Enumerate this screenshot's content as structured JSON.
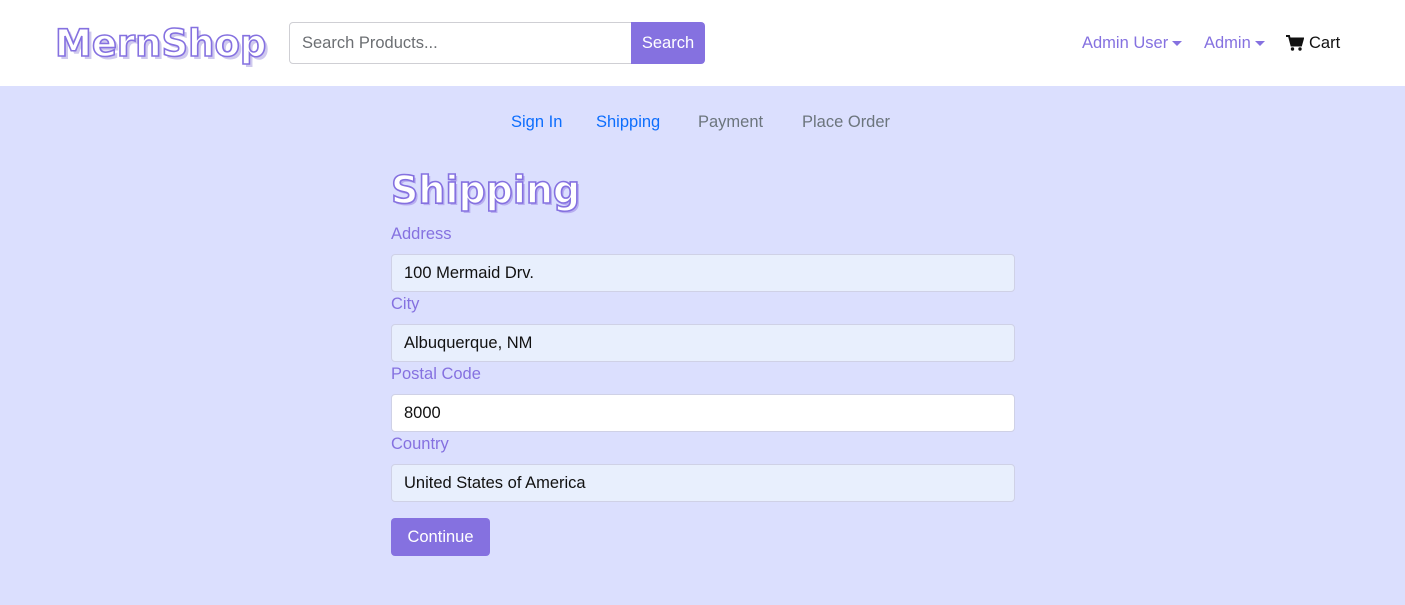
{
  "brand": {
    "name": "MernShop"
  },
  "search": {
    "placeholder": "Search Products...",
    "button_label": "Search"
  },
  "nav": {
    "user_menu_label": "Admin User",
    "admin_menu_label": "Admin",
    "cart_label": "Cart",
    "cart_icon": "shopping-cart-icon"
  },
  "checkout_steps": [
    {
      "label": "Sign In",
      "state": "active"
    },
    {
      "label": "Shipping",
      "state": "active"
    },
    {
      "label": "Payment",
      "state": "disabled"
    },
    {
      "label": "Place Order",
      "state": "disabled"
    }
  ],
  "shipping_form": {
    "title": "Shipping",
    "address": {
      "label": "Address",
      "value": "100 Mermaid Drv."
    },
    "city": {
      "label": "City",
      "value": "Albuquerque, NM"
    },
    "postal_code": {
      "label": "Postal Code",
      "value": "8000"
    },
    "country": {
      "label": "Country",
      "value": "United States of America"
    },
    "continue_label": "Continue"
  },
  "colors": {
    "accent": "#8571e0",
    "page_background": "#dbdffe",
    "active_link": "#0d6efd",
    "disabled_link": "#6c757d",
    "autofill_background": "#e8effd"
  }
}
